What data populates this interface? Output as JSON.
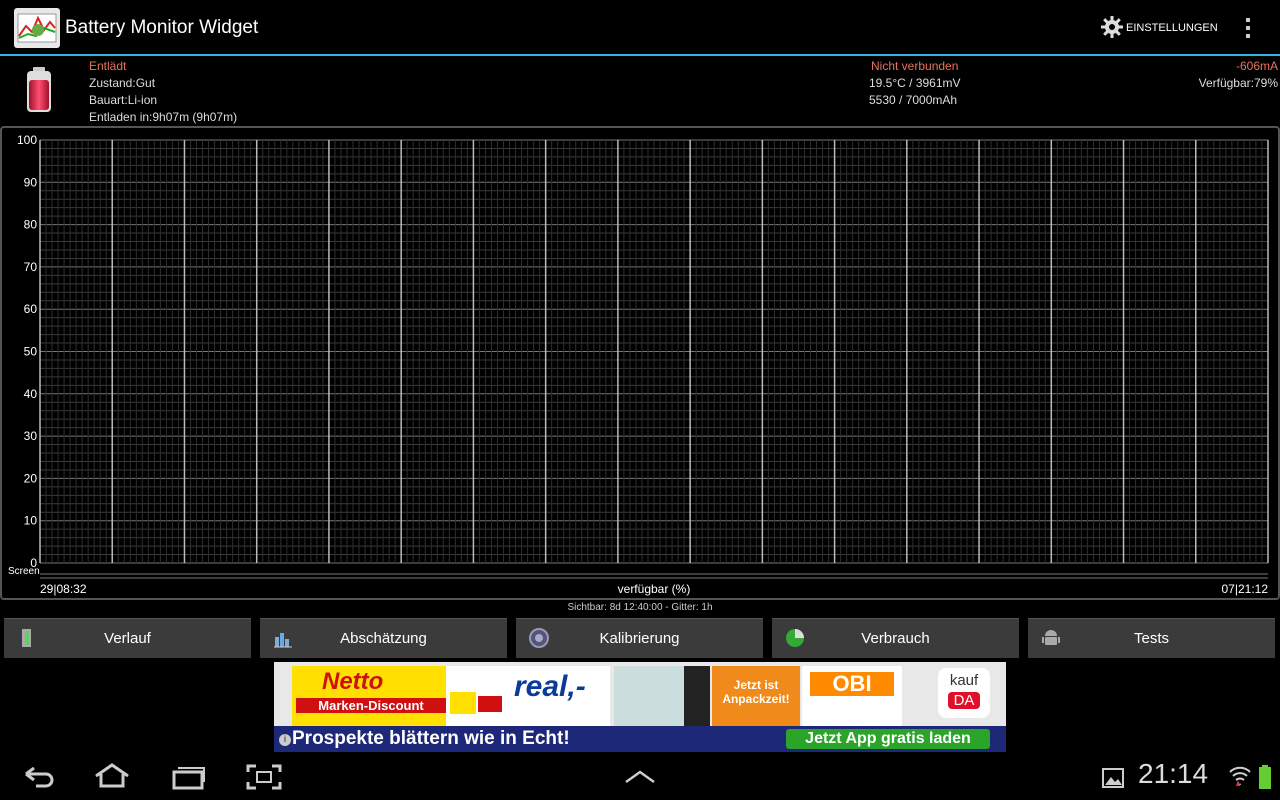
{
  "app": {
    "title": "Battery Monitor Widget",
    "settings_label": "EINSTELLUNGEN"
  },
  "status": {
    "state": "Entlädt",
    "condition": "Zustand:Gut",
    "type": "Bauart:Li-ion",
    "discharge_time": "Entladen in:9h07m (9h07m)",
    "connection": "Nicht verbunden",
    "temp_voltage": "19.5°C / 3961mV",
    "capacity": "5530 / 7000mAh",
    "current": "-606mA",
    "available": "Verfügbar:79%"
  },
  "chart_data": {
    "type": "line",
    "y_ticks": [
      "100",
      "90",
      "80",
      "70",
      "60",
      "50",
      "40",
      "30",
      "20",
      "10",
      "0"
    ],
    "ylim": [
      0,
      100
    ],
    "grid": true,
    "row_label": "Screen",
    "x_start": "29|08:32",
    "x_end": "07|21:12",
    "xlabel": "verfügbar (%)",
    "series": []
  },
  "chart_info": "Sichtbar: 8d 12:40:00 - Gitter: 1h",
  "tabs": [
    {
      "label": "Verlauf",
      "icon": "history-icon"
    },
    {
      "label": "Abschätzung",
      "icon": "estimate-icon"
    },
    {
      "label": "Kalibrierung",
      "icon": "calibration-icon"
    },
    {
      "label": "Verbrauch",
      "icon": "consumption-icon"
    },
    {
      "label": "Tests",
      "icon": "android-icon"
    }
  ],
  "ad": {
    "headline": "Prospekte blättern wie in Echt!",
    "cta": "Jetzt App gratis laden",
    "brand1": "Netto",
    "brand1_sub": "Marken-Discount",
    "brand2": "real,-",
    "brand3": "OBI",
    "brand4_line1": "kauf",
    "brand4_line2": "DA",
    "sticker": "Jetzt ist Anpackzeit!"
  },
  "systembar": {
    "time": "21:14"
  },
  "colors": {
    "accent": "#33b5e5",
    "status_red": "#e8735a",
    "cta_green": "#2aa52a"
  }
}
